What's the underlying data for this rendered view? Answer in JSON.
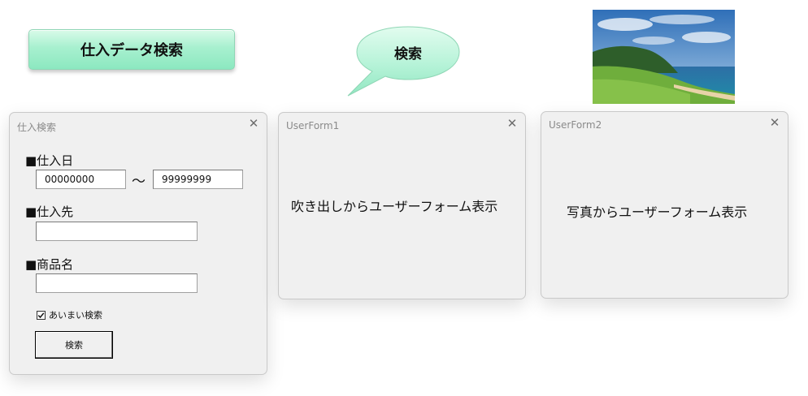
{
  "top_button": {
    "label": "仕入データ検索"
  },
  "bubble": {
    "label": "検索"
  },
  "photo": {
    "subject": "coastal landscape photo"
  },
  "form_search": {
    "title": "仕入検索",
    "close": "✕",
    "date_label": "■仕入日",
    "date_from": "00000000",
    "tilde": "～",
    "date_to": "99999999",
    "supplier_label": "■仕入先",
    "supplier_value": "",
    "product_label": "■商品名",
    "product_value": "",
    "fuzzy_label": "あいまい検索",
    "fuzzy_checked": true,
    "search_button": "検索"
  },
  "userform1": {
    "title": "UserForm1",
    "close": "✕",
    "text": "吹き出しからユーザーフォーム表示"
  },
  "userform2": {
    "title": "UserForm2",
    "close": "✕",
    "text": "写真からユーザーフォーム表示"
  },
  "colors": {
    "shape_fill": "#a7f0cf",
    "bubble_fill": "#b6f3d8",
    "form_bg": "#f0f0f0"
  }
}
